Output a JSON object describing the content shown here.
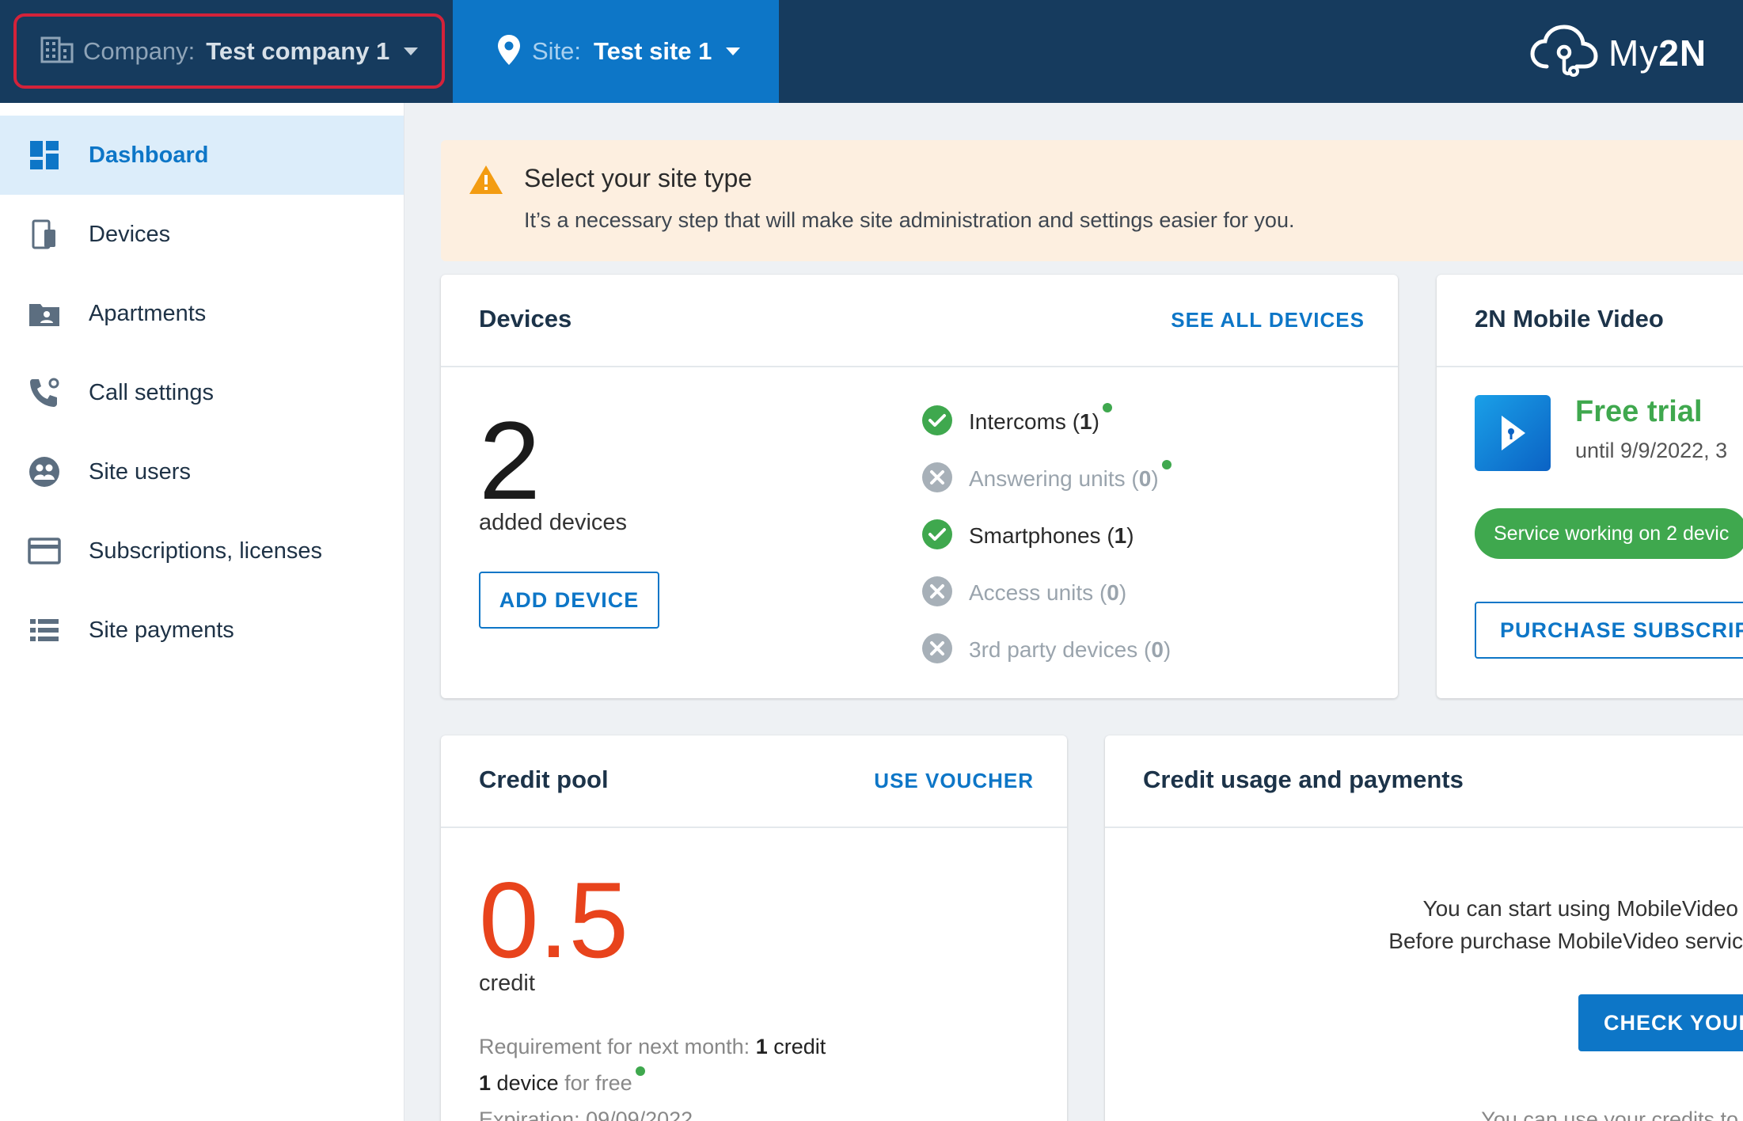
{
  "header": {
    "company_label": "Company:",
    "company_value": "Test company 1",
    "site_label": "Site:",
    "site_value": "Test site 1",
    "logo_text_light": "My",
    "logo_text_bold": "2N"
  },
  "sidebar": {
    "items": [
      {
        "label": "Dashboard",
        "icon": "dashboard-icon",
        "active": true
      },
      {
        "label": "Devices",
        "icon": "devices-icon"
      },
      {
        "label": "Apartments",
        "icon": "apartments-icon"
      },
      {
        "label": "Call settings",
        "icon": "call-settings-icon"
      },
      {
        "label": "Site users",
        "icon": "site-users-icon"
      },
      {
        "label": "Subscriptions, licenses",
        "icon": "credit-card-icon"
      },
      {
        "label": "Site payments",
        "icon": "list-icon"
      }
    ]
  },
  "alert": {
    "title": "Select your site type",
    "text": "It’s a necessary step that will make site administration and settings easier for you."
  },
  "devices": {
    "title": "Devices",
    "link": "SEE ALL DEVICES",
    "count": "2",
    "count_label": "added devices",
    "add_button": "ADD DEVICE",
    "list": [
      {
        "name": "Intercoms",
        "count": "1",
        "active": true
      },
      {
        "name": "Answering units",
        "count": "0",
        "active": false
      },
      {
        "name": "Smartphones",
        "count": "1",
        "active": true
      },
      {
        "name": "Access units",
        "count": "0",
        "active": false
      },
      {
        "name": "3rd party devices",
        "count": "0",
        "active": false
      }
    ]
  },
  "mobile_video": {
    "title": "2N Mobile Video",
    "trial": "Free trial",
    "until": "until 9/9/2022, 3",
    "pill": "Service working on 2 devic",
    "button": "PURCHASE SUBSCRIPT"
  },
  "credit_pool": {
    "title": "Credit pool",
    "link": "USE VOUCHER",
    "value": "0.5",
    "unit": "credit",
    "req_label": "Requirement for next month:",
    "req_num": "1",
    "req_unit": "credit",
    "free_num": "1",
    "free_device": "device",
    "free_suffix": "for free",
    "expiration": "Expiration: 09/09/2022"
  },
  "usage": {
    "title": "Credit usage and payments",
    "line1": "You can start using MobileVideo",
    "line2": "Before purchase MobileVideo servic",
    "button": "CHECK YOUR",
    "line3": "You can use your credits to"
  },
  "colors": {
    "topbar": "#163b5e",
    "site_bg": "#0d76c7",
    "accent": "#0d76c7",
    "success": "#3fa84e",
    "credit": "#e8431c",
    "alert_bg": "#fdefe0"
  }
}
